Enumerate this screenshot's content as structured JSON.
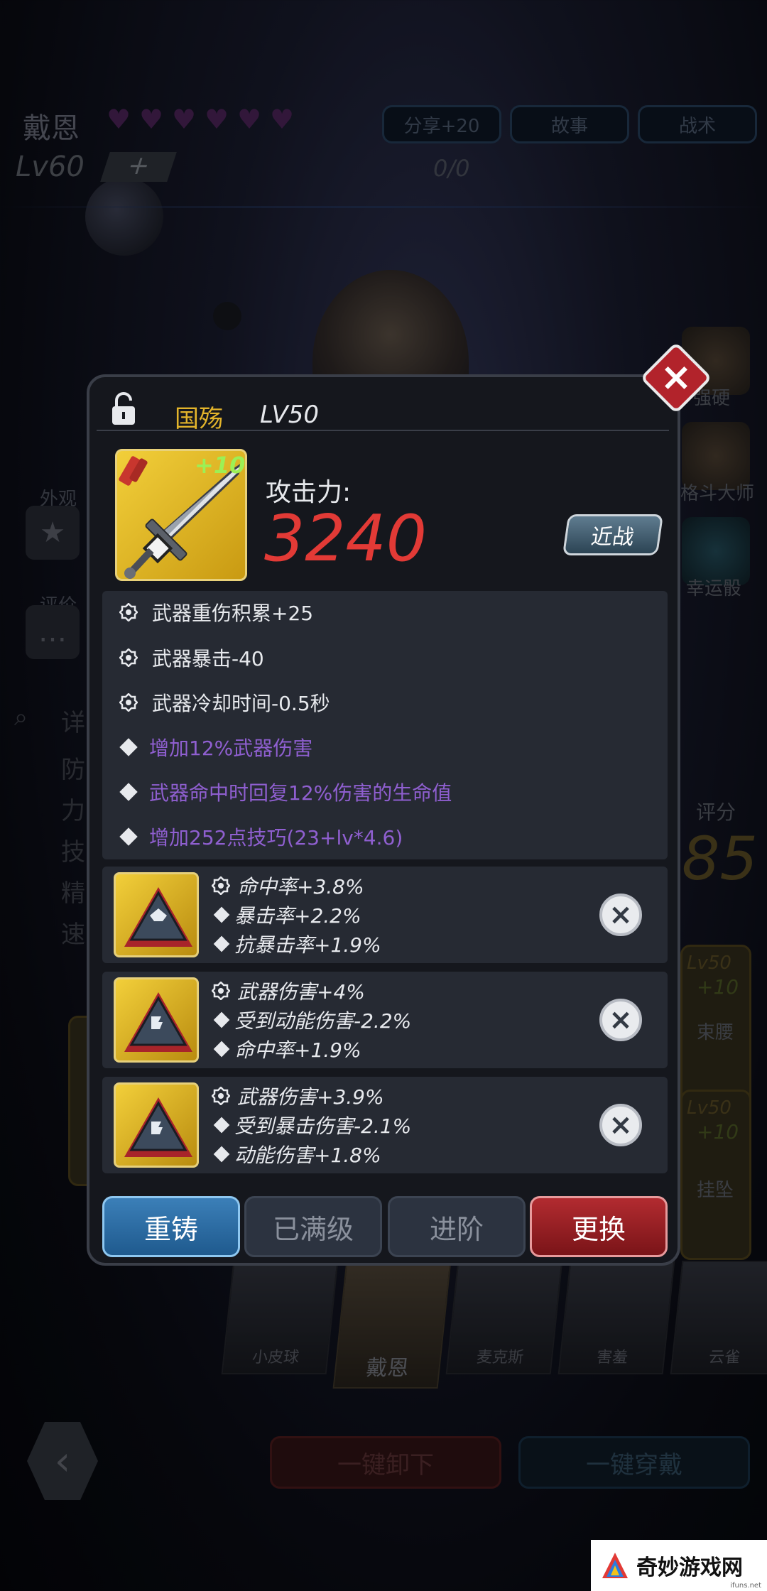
{
  "hero": {
    "name": "戴恩",
    "level": "Lv60",
    "plus": "+",
    "exp": "0/0",
    "hearts": 6
  },
  "top_buttons": {
    "share": "分享+20",
    "story": "故事",
    "tactics": "战术"
  },
  "side_left": {
    "appearance": "外观",
    "rating": "评价",
    "details": "详"
  },
  "side_stats": [
    "防",
    "力",
    "技",
    "精",
    "速"
  ],
  "side_right": {
    "harden": "强硬",
    "fight_master": "格斗大师",
    "lucky_dice": "幸运骰"
  },
  "score": {
    "label": "评分",
    "value": "85"
  },
  "equip_slots": [
    {
      "level": "Lv50",
      "enh": "+10",
      "name": "束腰"
    },
    {
      "level": "Lv50",
      "enh": "+10",
      "name": "挂坠"
    }
  ],
  "item": {
    "name": "国殇",
    "level": "LV50",
    "enhance": "+10",
    "atk_label": "攻击力:",
    "atk_value": "3240",
    "type_button": "近战"
  },
  "attributes": [
    {
      "text": "武器重伤积累+25",
      "style": "white",
      "icon": "gear-icon"
    },
    {
      "text": "武器暴击-40",
      "style": "white",
      "icon": "gear-icon"
    },
    {
      "text": "武器冷却时间-0.5秒",
      "style": "white",
      "icon": "gear-icon"
    },
    {
      "text": "增加12%武器伤害",
      "style": "purple",
      "icon": "diamond-icon"
    },
    {
      "text": "武器命中时回复12%伤害的生命值",
      "style": "purple",
      "icon": "diamond-icon"
    },
    {
      "text": "增加252点技巧(23+lv*4.6)",
      "style": "purple",
      "icon": "diamond-icon"
    }
  ],
  "sockets": [
    {
      "lines": [
        "命中率+3.8%",
        "暴击率+2.2%",
        "抗暴击率+1.9%"
      ]
    },
    {
      "lines": [
        "武器伤害+4%",
        "受到动能伤害-2.2%",
        "命中率+1.9%"
      ]
    },
    {
      "lines": [
        "武器伤害+3.9%",
        "受到暴击伤害-2.1%",
        "动能伤害+1.8%"
      ]
    }
  ],
  "actions": {
    "recast": "重铸",
    "maxed": "已满级",
    "advance": "进阶",
    "change": "更换"
  },
  "portraits": [
    "小皮球",
    "戴恩",
    "麦克斯",
    "害羞",
    "云雀"
  ],
  "bottom": {
    "unequip_all": "一键卸下",
    "equip_all": "一键穿戴"
  },
  "watermark": {
    "text": "奇妙游戏网",
    "sub": "ifuns.net"
  },
  "colors": {
    "accent_gold": "#e3b42b",
    "attack_red": "#e23a36",
    "purple_attr": "#8f5fd0",
    "close_red": "#b2232b"
  }
}
